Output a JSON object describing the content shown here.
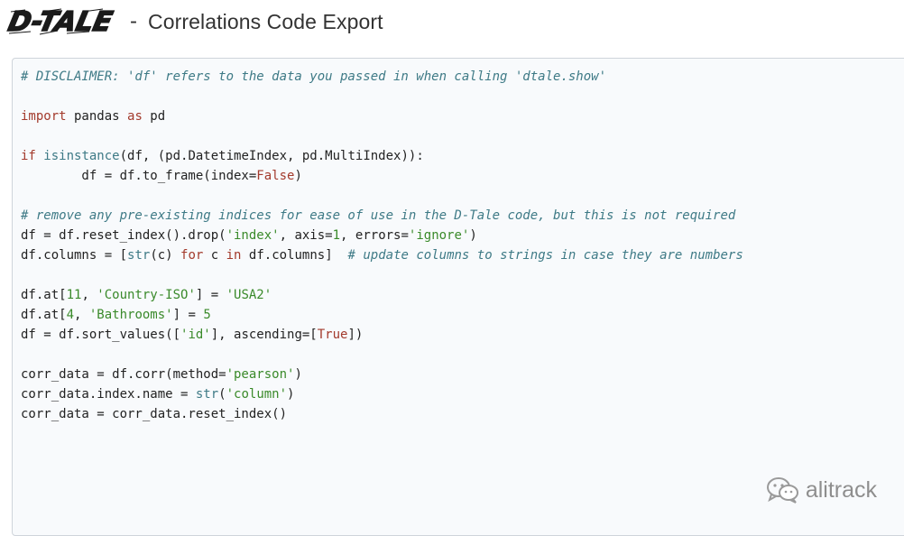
{
  "header": {
    "logo_text": "D-TALE",
    "separator": "-",
    "title": "Correlations Code Export"
  },
  "code": {
    "lines": [
      [
        {
          "t": "# DISCLAIMER: 'df' refers to the data you passed in when calling 'dtale.show'",
          "c": "cm"
        }
      ],
      [],
      [
        {
          "t": "import",
          "c": "kw"
        },
        {
          "t": " pandas "
        },
        {
          "t": "as",
          "c": "kw"
        },
        {
          "t": " pd"
        }
      ],
      [],
      [
        {
          "t": "if",
          "c": "kw"
        },
        {
          "t": " "
        },
        {
          "t": "isinstance",
          "c": "bi"
        },
        {
          "t": "(df, (pd.DatetimeIndex, pd.MultiIndex)):"
        }
      ],
      [
        {
          "t": "        df = df.to_frame(index="
        },
        {
          "t": "False",
          "c": "const"
        },
        {
          "t": ")"
        }
      ],
      [],
      [
        {
          "t": "# remove any pre-existing indices for ease of use in the D-Tale code, but this is not required",
          "c": "cm"
        }
      ],
      [
        {
          "t": "df = df.reset_index().drop("
        },
        {
          "t": "'index'",
          "c": "str"
        },
        {
          "t": ", axis="
        },
        {
          "t": "1",
          "c": "num"
        },
        {
          "t": ", errors="
        },
        {
          "t": "'ignore'",
          "c": "str"
        },
        {
          "t": ")"
        }
      ],
      [
        {
          "t": "df.columns = ["
        },
        {
          "t": "str",
          "c": "bi"
        },
        {
          "t": "(c) "
        },
        {
          "t": "for",
          "c": "kw"
        },
        {
          "t": " c "
        },
        {
          "t": "in",
          "c": "kw"
        },
        {
          "t": " df.columns]  "
        },
        {
          "t": "# update columns to strings in case they are numbers",
          "c": "cm"
        }
      ],
      [],
      [
        {
          "t": "df.at["
        },
        {
          "t": "11",
          "c": "num"
        },
        {
          "t": ", "
        },
        {
          "t": "'Country-ISO'",
          "c": "str"
        },
        {
          "t": "] = "
        },
        {
          "t": "'USA2'",
          "c": "str"
        }
      ],
      [
        {
          "t": "df.at["
        },
        {
          "t": "4",
          "c": "num"
        },
        {
          "t": ", "
        },
        {
          "t": "'Bathrooms'",
          "c": "str"
        },
        {
          "t": "] = "
        },
        {
          "t": "5",
          "c": "num"
        }
      ],
      [
        {
          "t": "df = df.sort_values(["
        },
        {
          "t": "'id'",
          "c": "str"
        },
        {
          "t": "], ascending=["
        },
        {
          "t": "True",
          "c": "const"
        },
        {
          "t": "])"
        }
      ],
      [],
      [
        {
          "t": "corr_data = df.corr(method="
        },
        {
          "t": "'pearson'",
          "c": "str"
        },
        {
          "t": ")"
        }
      ],
      [
        {
          "t": "corr_data.index.name = "
        },
        {
          "t": "str",
          "c": "bi"
        },
        {
          "t": "("
        },
        {
          "t": "'column'",
          "c": "str"
        },
        {
          "t": ")"
        }
      ],
      [
        {
          "t": "corr_data = corr_data.reset_index()"
        }
      ]
    ]
  },
  "watermark": {
    "text": "alitrack",
    "icon": "wechat-icon"
  },
  "colors": {
    "comment": "#3e7a86",
    "keyword": "#a33a2c",
    "string": "#3a8a2a",
    "panel_bg": "#f8fafc",
    "panel_border": "#cfd4da"
  }
}
